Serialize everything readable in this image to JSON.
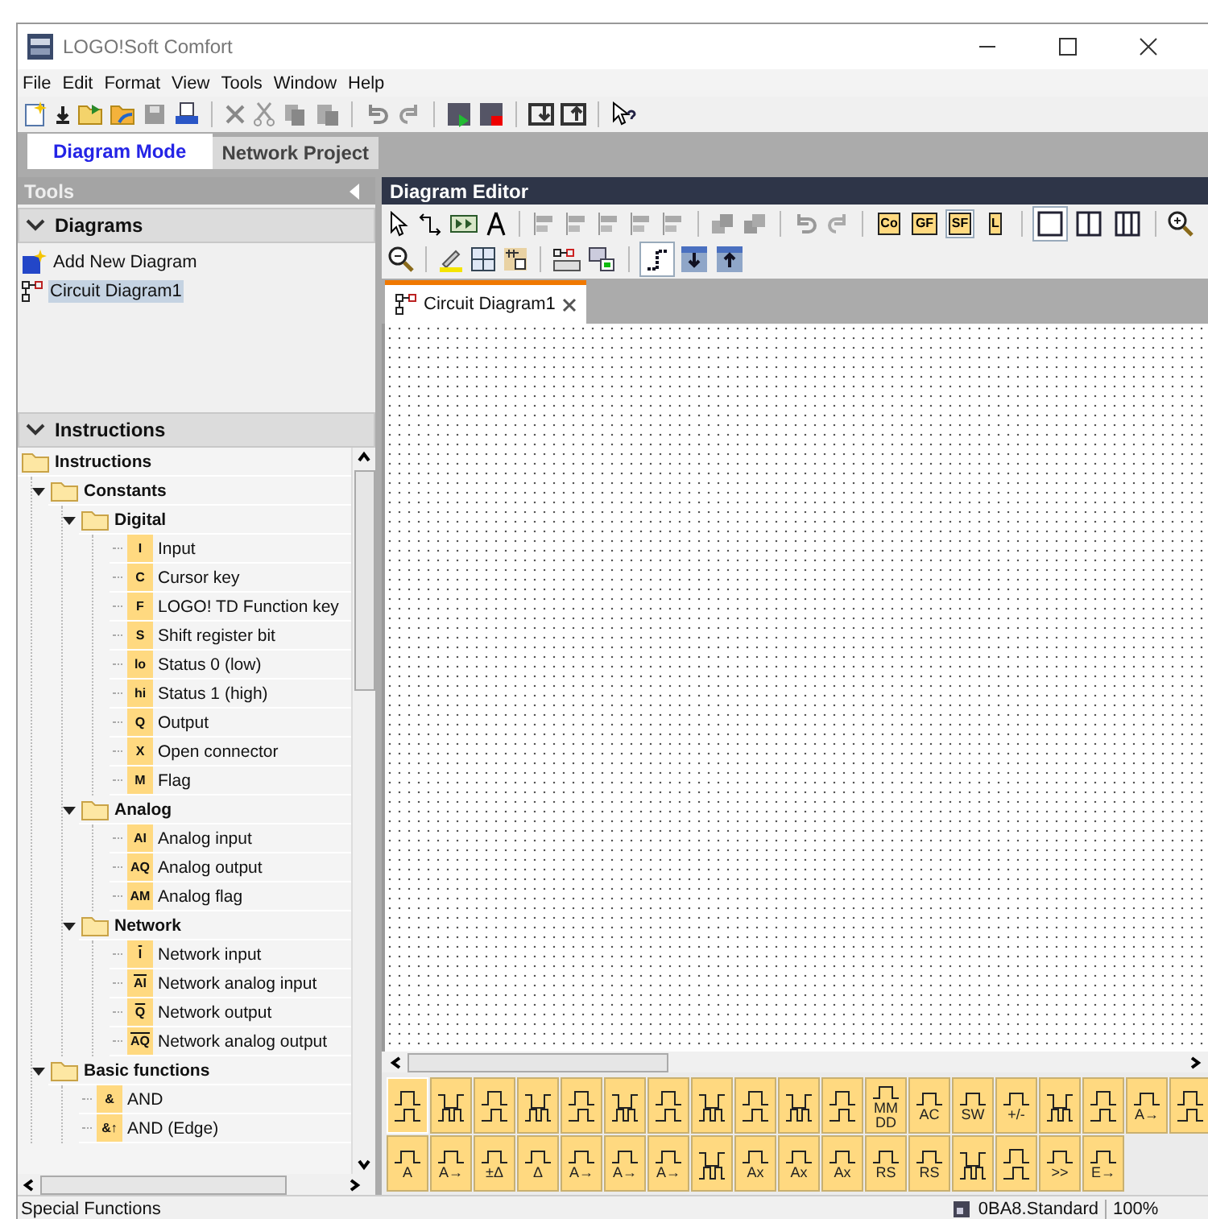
{
  "window": {
    "title": "LOGO!Soft Comfort"
  },
  "menu": [
    "File",
    "Edit",
    "Format",
    "View",
    "Tools",
    "Window",
    "Help"
  ],
  "mode_tabs": [
    {
      "label": "Diagram Mode",
      "selected": true
    },
    {
      "label": "Network Project",
      "selected": false
    }
  ],
  "tools_panel": {
    "title": "Tools",
    "diagrams": {
      "title": "Diagrams",
      "expanded": true,
      "items": [
        {
          "label": "Add New Diagram",
          "kind": "add",
          "selected": false
        },
        {
          "label": "Circuit Diagram1",
          "kind": "diagram",
          "selected": true
        }
      ]
    },
    "instructions": {
      "title": "Instructions",
      "expanded": true,
      "tree": [
        {
          "label": "Instructions",
          "expanded": true,
          "children": [
            {
              "label": "Constants",
              "expanded": true,
              "children": [
                {
                  "label": "Digital",
                  "expanded": true,
                  "children": [
                    {
                      "label": "Input",
                      "badge": "I"
                    },
                    {
                      "label": "Cursor key",
                      "badge": "C"
                    },
                    {
                      "label": "LOGO! TD Function key",
                      "badge": "F"
                    },
                    {
                      "label": "Shift register bit",
                      "badge": "S"
                    },
                    {
                      "label": "Status 0 (low)",
                      "badge": "lo"
                    },
                    {
                      "label": "Status 1 (high)",
                      "badge": "hi"
                    },
                    {
                      "label": "Output",
                      "badge": "Q"
                    },
                    {
                      "label": "Open connector",
                      "badge": "X"
                    },
                    {
                      "label": "Flag",
                      "badge": "M"
                    }
                  ]
                },
                {
                  "label": "Analog",
                  "expanded": true,
                  "children": [
                    {
                      "label": "Analog input",
                      "badge": "AI"
                    },
                    {
                      "label": "Analog output",
                      "badge": "AQ"
                    },
                    {
                      "label": "Analog flag",
                      "badge": "AM"
                    }
                  ]
                },
                {
                  "label": "Network",
                  "expanded": true,
                  "children": [
                    {
                      "label": "Network input",
                      "badge": "I",
                      "network": true
                    },
                    {
                      "label": "Network analog input",
                      "badge": "AI",
                      "network": true
                    },
                    {
                      "label": "Network output",
                      "badge": "Q",
                      "network": true
                    },
                    {
                      "label": "Network analog output",
                      "badge": "AQ",
                      "network": true
                    }
                  ]
                }
              ]
            },
            {
              "label": "Basic functions",
              "expanded": true,
              "children": [
                {
                  "label": "AND",
                  "badge": "&"
                },
                {
                  "label": "AND (Edge)",
                  "badge": "&↑"
                }
              ]
            }
          ]
        }
      ]
    }
  },
  "editor": {
    "title": "Diagram Editor",
    "view_buttons": [
      {
        "label": "Co",
        "selected": false
      },
      {
        "label": "GF",
        "selected": false
      },
      {
        "label": "SF",
        "selected": true
      },
      {
        "label": "L",
        "selected": false
      }
    ],
    "doc_tabs": [
      {
        "label": "Circuit Diagram1",
        "selected": true
      }
    ],
    "palette": [
      [
        {
          "kind": "pulse"
        },
        {
          "kind": "pulse"
        },
        {
          "kind": "pulse"
        },
        {
          "kind": "pulse"
        },
        {
          "kind": "pulse"
        },
        {
          "kind": "pulse"
        },
        {
          "kind": "pulse"
        },
        {
          "kind": "pulse"
        },
        {
          "kind": "pulse"
        },
        {
          "kind": "pulse"
        },
        {
          "kind": "pulse"
        },
        {
          "kind": "text",
          "label": "MM DD"
        },
        {
          "kind": "text",
          "label": "AC"
        },
        {
          "kind": "text",
          "label": "SW"
        },
        {
          "kind": "text",
          "label": "+/-"
        },
        {
          "kind": "pulse"
        },
        {
          "kind": "pulse"
        },
        {
          "kind": "text",
          "label": "A→"
        },
        {
          "kind": "pulse"
        }
      ],
      [
        {
          "kind": "text",
          "label": "A"
        },
        {
          "kind": "text",
          "label": "A→"
        },
        {
          "kind": "text",
          "label": "±Δ"
        },
        {
          "kind": "text",
          "label": "Δ"
        },
        {
          "kind": "text",
          "label": "A→"
        },
        {
          "kind": "text",
          "label": "A→"
        },
        {
          "kind": "text",
          "label": "A→"
        },
        {
          "kind": "pulse"
        },
        {
          "kind": "text",
          "label": "Ax"
        },
        {
          "kind": "text",
          "label": "Ax"
        },
        {
          "kind": "text",
          "label": "Ax"
        },
        {
          "kind": "text",
          "label": "RS"
        },
        {
          "kind": "text",
          "label": "RS"
        },
        {
          "kind": "pulse"
        },
        {
          "kind": "pulse"
        },
        {
          "kind": "text",
          "label": ">>"
        },
        {
          "kind": "text",
          "label": "E→"
        }
      ]
    ]
  },
  "status_bar": {
    "message": "Special Functions",
    "device": "0BA8.Standard",
    "zoom": "100%"
  }
}
